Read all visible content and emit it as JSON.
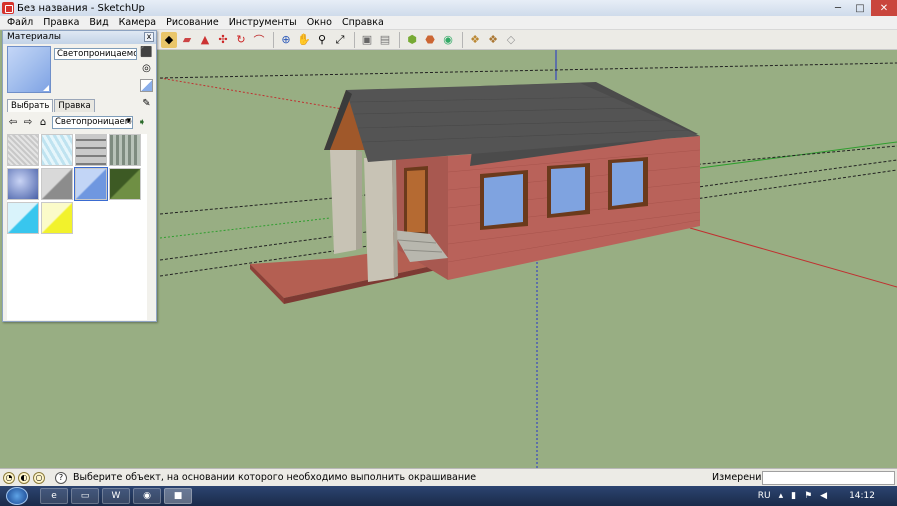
{
  "window": {
    "title": "Без названия - SketchUp",
    "minimize": "─",
    "maximize": "□",
    "close": "✕"
  },
  "menu": [
    {
      "label": "Файл"
    },
    {
      "label": "Правка"
    },
    {
      "label": "Вид"
    },
    {
      "label": "Камера"
    },
    {
      "label": "Рисование"
    },
    {
      "label": "Инструменты"
    },
    {
      "label": "Окно"
    },
    {
      "label": "Справка"
    }
  ],
  "materials": {
    "panel_title": "Материалы",
    "close_glyph": "x",
    "material_name": "Светопроницаемое – ст",
    "tab_select": "Выбрать",
    "tab_edit": "Правка",
    "library": "Светопроницаемое",
    "selected_color": "#8aaeea"
  },
  "statusbar": {
    "help_glyph": "?",
    "hint": "Выберите объект, на основании которого необходимо выполнить окрашивание",
    "measurements_label": "Измерения",
    "measurements_value": ""
  },
  "taskbar": {
    "language": "RU",
    "time": "14:12"
  },
  "colors": {
    "ground": "#98ae83",
    "roof": "#545454",
    "brick": "#b9625a",
    "glass": "#7fa3e0",
    "window_frame": "#6b3a1c"
  }
}
